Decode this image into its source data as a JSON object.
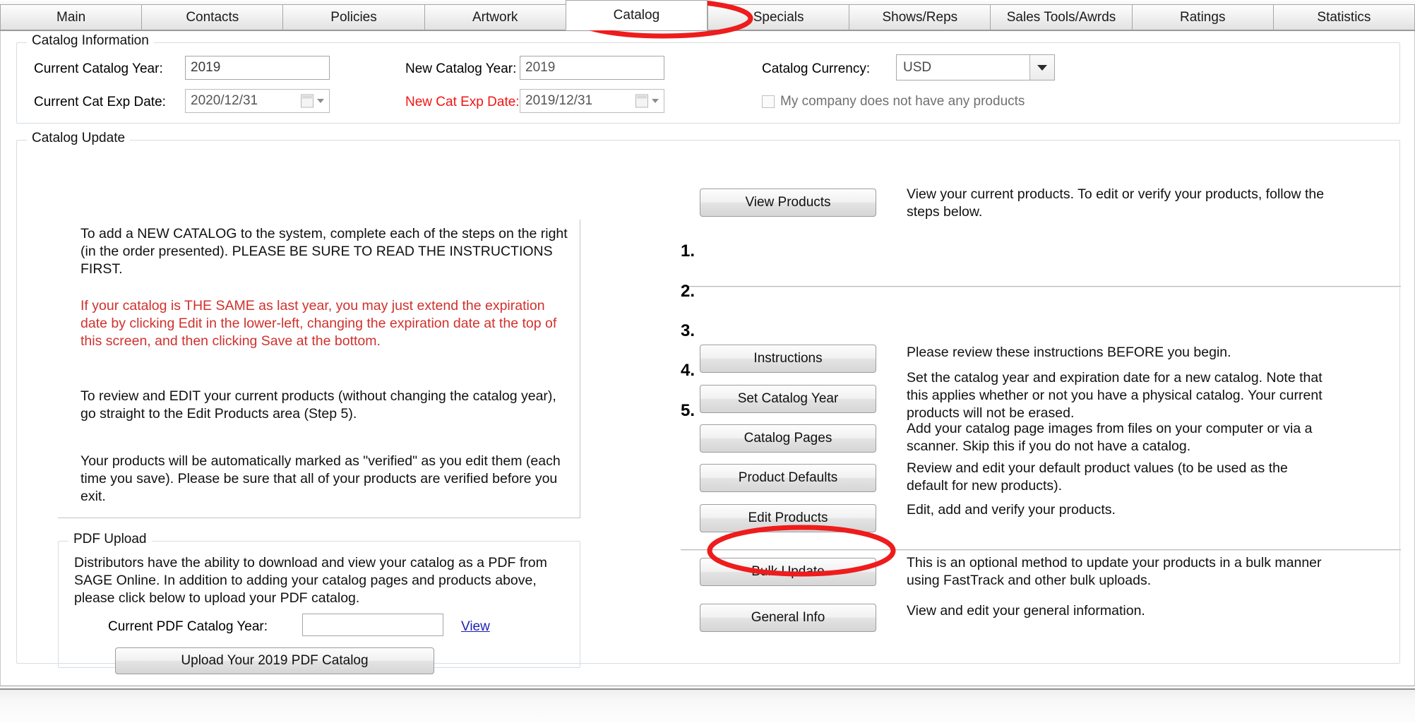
{
  "tabs": [
    {
      "label": "Main",
      "active": false
    },
    {
      "label": "Contacts",
      "active": false
    },
    {
      "label": "Policies",
      "active": false
    },
    {
      "label": "Artwork",
      "active": false
    },
    {
      "label": "Catalog",
      "active": true
    },
    {
      "label": "Specials",
      "active": false
    },
    {
      "label": "Shows/Reps",
      "active": false
    },
    {
      "label": "Sales Tools/Awrds",
      "active": false
    },
    {
      "label": "Ratings",
      "active": false
    },
    {
      "label": "Statistics",
      "active": false
    }
  ],
  "catalog_information": {
    "group_label": "Catalog Information",
    "current_catalog_year": {
      "label": "Current Catalog Year:",
      "value": "2019"
    },
    "new_catalog_year": {
      "label": "New Catalog Year:",
      "value": "2019"
    },
    "catalog_currency": {
      "label": "Catalog Currency:",
      "value": "USD"
    },
    "current_cat_exp_date": {
      "label": "Current Cat Exp Date:",
      "value": "2020/12/31"
    },
    "new_cat_exp_date": {
      "label": "New Cat Exp Date:",
      "value": "2019/12/31"
    },
    "no_products_checkbox": {
      "label": "My company does not have any products",
      "checked": false
    }
  },
  "catalog_update": {
    "group_label": "Catalog Update",
    "instructions": [
      {
        "text": "To add a NEW CATALOG to the system, complete each of the steps on the right (in the order presented).  PLEASE BE SURE TO READ THE INSTRUCTIONS FIRST.",
        "color": "black"
      },
      {
        "text": "If your catalog is THE SAME as last year, you may just extend the expiration date by clicking Edit in the lower-left, changing the expiration date at the top of this screen, and then clicking Save at the bottom.",
        "color": "red"
      },
      {
        "text": "To review and EDIT your current products (without changing the catalog year), go straight to the Edit Products area (Step 5).",
        "color": "black"
      },
      {
        "text": "Your products will be automatically marked as \"verified\" as you edit them (each time you save).  Please be sure that all of your products are verified before you exit.",
        "color": "black"
      }
    ],
    "pdf_upload": {
      "group_label": "PDF Upload",
      "body": "Distributors have the ability to download and view your catalog as a PDF from SAGE Online.  In addition to adding your catalog pages and products above, please click below to upload your PDF catalog.",
      "year_label": "Current PDF Catalog Year:",
      "year_value": "",
      "view_link": "View",
      "upload_button": "Upload Your 2019 PDF Catalog"
    },
    "view_products": {
      "button": "View Products",
      "description": "View your current products.  To edit or verify your products, follow the steps below."
    },
    "steps": [
      {
        "num": "1.",
        "button": "Instructions",
        "description": "Please review these instructions BEFORE you begin."
      },
      {
        "num": "2.",
        "button": "Set Catalog Year",
        "description": "Set the catalog year and expiration date for a new catalog. Note that this applies whether or not you have a physical catalog.  Your current products will not be erased."
      },
      {
        "num": "3.",
        "button": "Catalog Pages",
        "description": "Add your catalog page images from files on your computer or via a scanner. Skip this if you do not have a catalog."
      },
      {
        "num": "4.",
        "button": "Product Defaults",
        "description": "Review and edit your default product values (to be used as the default for new products)."
      },
      {
        "num": "5.",
        "button": "Edit Products",
        "description": "Edit, add and verify your products."
      }
    ],
    "extras": [
      {
        "button": "Bulk Update",
        "description": "This is an optional method to update your products in a bulk manner using FastTrack and other bulk uploads."
      },
      {
        "button": "General Info",
        "description": "View and edit your general information."
      }
    ]
  },
  "annotations": {
    "color": "#ee1c1c",
    "items": [
      {
        "name": "catalog-tab-highlight"
      },
      {
        "name": "bulk-update-highlight"
      }
    ]
  }
}
